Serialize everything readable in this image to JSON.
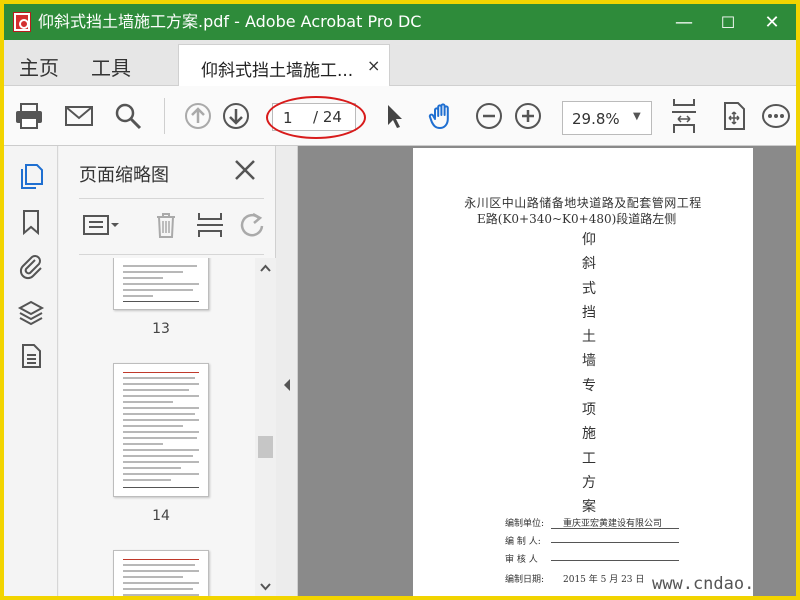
{
  "window": {
    "title": "仰斜式挡土墙施工方案.pdf - Adobe Acrobat Pro DC",
    "minimize": "—",
    "maximize": "☐",
    "close": "✕"
  },
  "menu": {
    "home": "主页",
    "tools": "工具",
    "tab_label": "仰斜式挡土墙施工...",
    "tab_close": "×"
  },
  "toolbar": {
    "current_page": "1",
    "total_pages": "/ 24",
    "zoom": "29.8%",
    "zoom_caret": "▼",
    "icons": [
      "print-icon",
      "mail-icon",
      "search-icon",
      "page-up-icon",
      "page-down-icon",
      "pointer-icon",
      "hand-icon",
      "zoom-out-icon",
      "zoom-in-icon",
      "fit-page-icon",
      "scroll-mode-icon",
      "more-icon"
    ]
  },
  "nav_rail": {
    "icons": [
      "pages-icon",
      "bookmark-icon",
      "attachment-icon",
      "layers-icon",
      "document-icon"
    ]
  },
  "thumbnails_panel": {
    "title": "页面缩略图",
    "close": "✕",
    "pages": [
      {
        "number": "13"
      },
      {
        "number": "14"
      }
    ]
  },
  "document": {
    "heading_line1": "永川区中山路储备地块道路及配套管网工程",
    "heading_line2": "E路(K0+340~K0+480)段道路左侧",
    "title_chars": [
      "仰",
      "斜",
      "式",
      "挡",
      "土",
      "墙",
      "专",
      "项",
      "施",
      "工",
      "方",
      "案"
    ],
    "prepared_by_unit_label": "编制单位:",
    "prepared_by_unit_value": "重庆亚宏黄建设有限公司",
    "preparer_label": "编 制 人:",
    "reviewer_label": "审 核 人",
    "date_label": "编制日期:",
    "date_value": "2015 年 5 月 23 日"
  },
  "watermark": "www.cndao."
}
